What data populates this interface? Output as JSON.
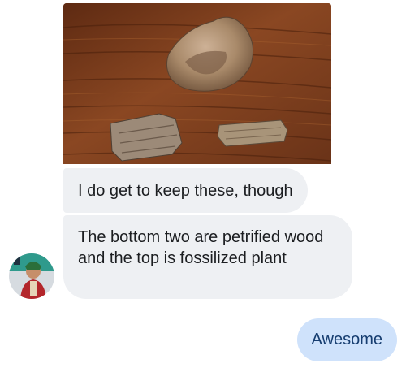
{
  "thread": {
    "incoming": [
      {
        "type": "photo",
        "icon": "fossil-photo"
      },
      {
        "type": "text",
        "text": "I do get to keep these, though"
      },
      {
        "type": "text",
        "text": "The bottom two are petrified wood and the top is fossilized plant"
      }
    ],
    "outgoing": [
      {
        "type": "text",
        "text": "Awesome"
      }
    ],
    "sender_avatar": {
      "icon": "contact-avatar"
    }
  },
  "colors": {
    "incoming_bubble": "#eef0f3",
    "outgoing_bubble": "#cfe2fb",
    "outgoing_text": "#163d70",
    "incoming_text": "#1c1e21"
  }
}
